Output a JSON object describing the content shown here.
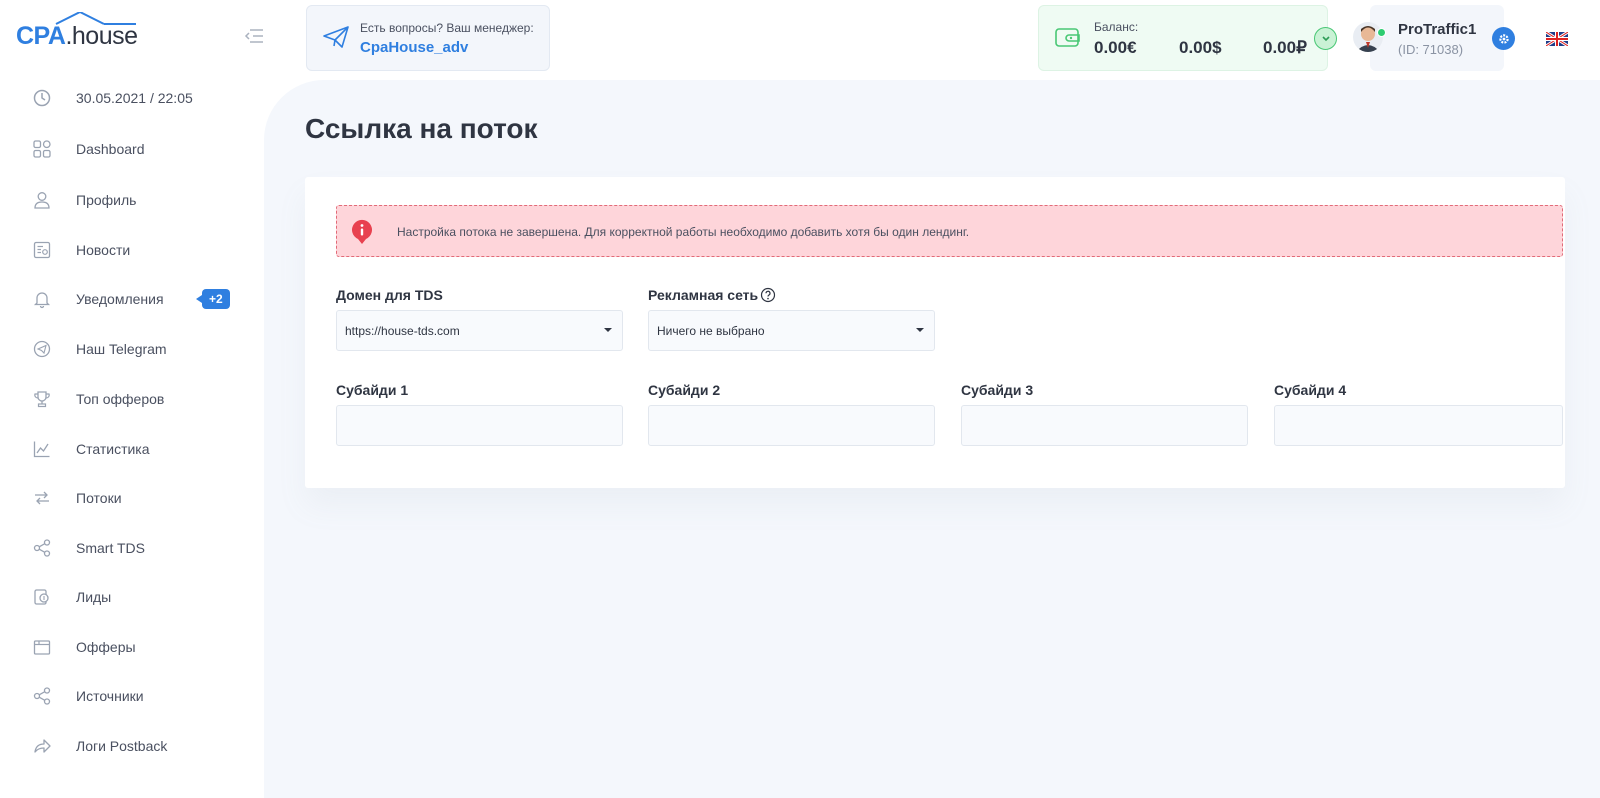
{
  "logo": {
    "part1": "CPA",
    "part2": ".house"
  },
  "manager": {
    "label": "Есть вопросы? Ваш менеджер:",
    "name": "CpaHouse_adv"
  },
  "balance": {
    "label": "Баланс:",
    "eur": "0.00€",
    "usd": "0.00$",
    "rub": "0.00₽"
  },
  "profile": {
    "username": "ProTraffic1",
    "user_id": "(ID: 71038)"
  },
  "sidebar": {
    "datetime": "30.05.2021 / 22:05",
    "items": [
      {
        "label": "Dashboard",
        "icon": "dashboard-icon"
      },
      {
        "label": "Профиль",
        "icon": "user-icon"
      },
      {
        "label": "Новости",
        "icon": "news-icon"
      },
      {
        "label": "Уведомления",
        "icon": "bell-icon",
        "badge": "+2"
      },
      {
        "label": "Наш Telegram",
        "icon": "telegram-icon"
      },
      {
        "label": "Топ офферов",
        "icon": "trophy-icon"
      },
      {
        "label": "Статистика",
        "icon": "chart-icon"
      },
      {
        "label": "Потоки",
        "icon": "flows-icon"
      },
      {
        "label": "Smart TDS",
        "icon": "share-icon"
      },
      {
        "label": "Лиды",
        "icon": "leads-icon"
      },
      {
        "label": "Офферы",
        "icon": "offers-icon"
      },
      {
        "label": "Источники",
        "icon": "share-icon"
      },
      {
        "label": "Логи Postback",
        "icon": "forward-icon"
      }
    ]
  },
  "page": {
    "title": "Ссылка на поток",
    "alert": "Настройка потока не завершена. Для корректной работы необходимо добавить хотя бы один лендинг.",
    "domain_label": "Домен для TDS",
    "domain_value": "https://house-tds.com",
    "adnet_label": "Рекламная сеть",
    "adnet_value": "Ничего не выбрано",
    "subid1_label": "Субайди 1",
    "subid2_label": "Субайди 2",
    "subid3_label": "Субайди 3",
    "subid4_label": "Субайди 4"
  },
  "colors": {
    "accent": "#2f7fe0",
    "alert_bg": "#fed5da",
    "alert_border": "#e26b78",
    "balance_bg": "#effbf3",
    "online": "#2ecc71"
  }
}
